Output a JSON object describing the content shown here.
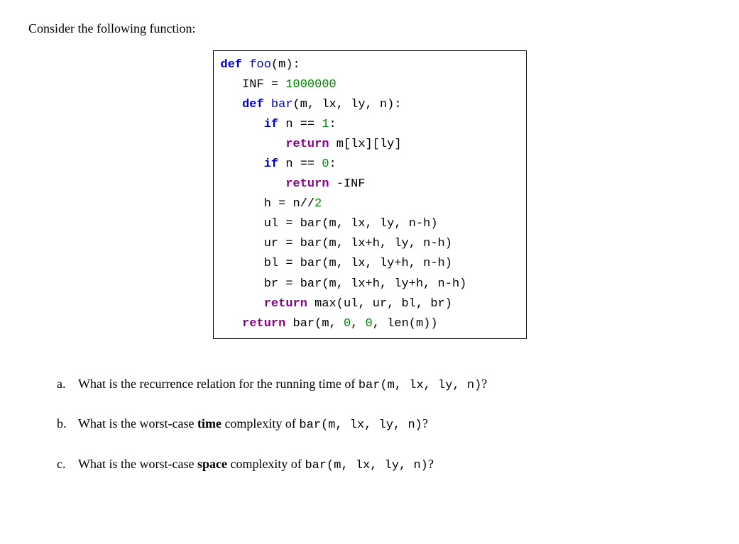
{
  "intro": "Consider the following function:",
  "code": {
    "l1": {
      "def": "def",
      "fn": "foo",
      "rest": "(m):"
    },
    "l2": {
      "pre": "   INF = ",
      "num": "1000000"
    },
    "l3": {
      "def": "def",
      "fn": "bar",
      "rest": "(m, lx, ly, n):"
    },
    "l4": {
      "pre": "      ",
      "ifkw": "if",
      "mid": " n == ",
      "num": "1",
      "colon": ":"
    },
    "l5": {
      "pre": "         ",
      "ret": "return",
      "rest": " m[lx][ly]"
    },
    "l6": {
      "pre": "      ",
      "ifkw": "if",
      "mid": " n == ",
      "num": "0",
      "colon": ":"
    },
    "l7": {
      "pre": "         ",
      "ret": "return",
      "rest": " -INF"
    },
    "l8": {
      "pre": "      h = n//",
      "num": "2"
    },
    "l9": "      ul = bar(m, lx, ly, n-h)",
    "l10": "      ur = bar(m, lx+h, ly, n-h)",
    "l11": "      bl = bar(m, lx, ly+h, n-h)",
    "l12": "      br = bar(m, lx+h, ly+h, n-h)",
    "l13": {
      "pre": "      ",
      "ret": "return",
      "rest": " max(ul, ur, bl, br)"
    },
    "l14": {
      "pre": "   ",
      "ret": "return",
      "rest1": " bar(m, ",
      "z1": "0",
      "c1": ", ",
      "z2": "0",
      "rest2": ", len(m))"
    }
  },
  "questions": {
    "a": {
      "marker": "a.",
      "t1": "What is the recurrence relation for the running time of ",
      "code": "bar(m, lx, ly, n)",
      "t2": "?"
    },
    "b": {
      "marker": "b.",
      "t1": "What is the worst-case ",
      "bold": "time",
      "t2": " complexity of ",
      "code": "bar(m, lx, ly, n)",
      "t3": "?"
    },
    "c": {
      "marker": "c.",
      "t1": "What is the worst-case ",
      "bold": "space",
      "t2": " complexity of ",
      "code": "bar(m, lx, ly, n)",
      "t3": "?"
    }
  }
}
